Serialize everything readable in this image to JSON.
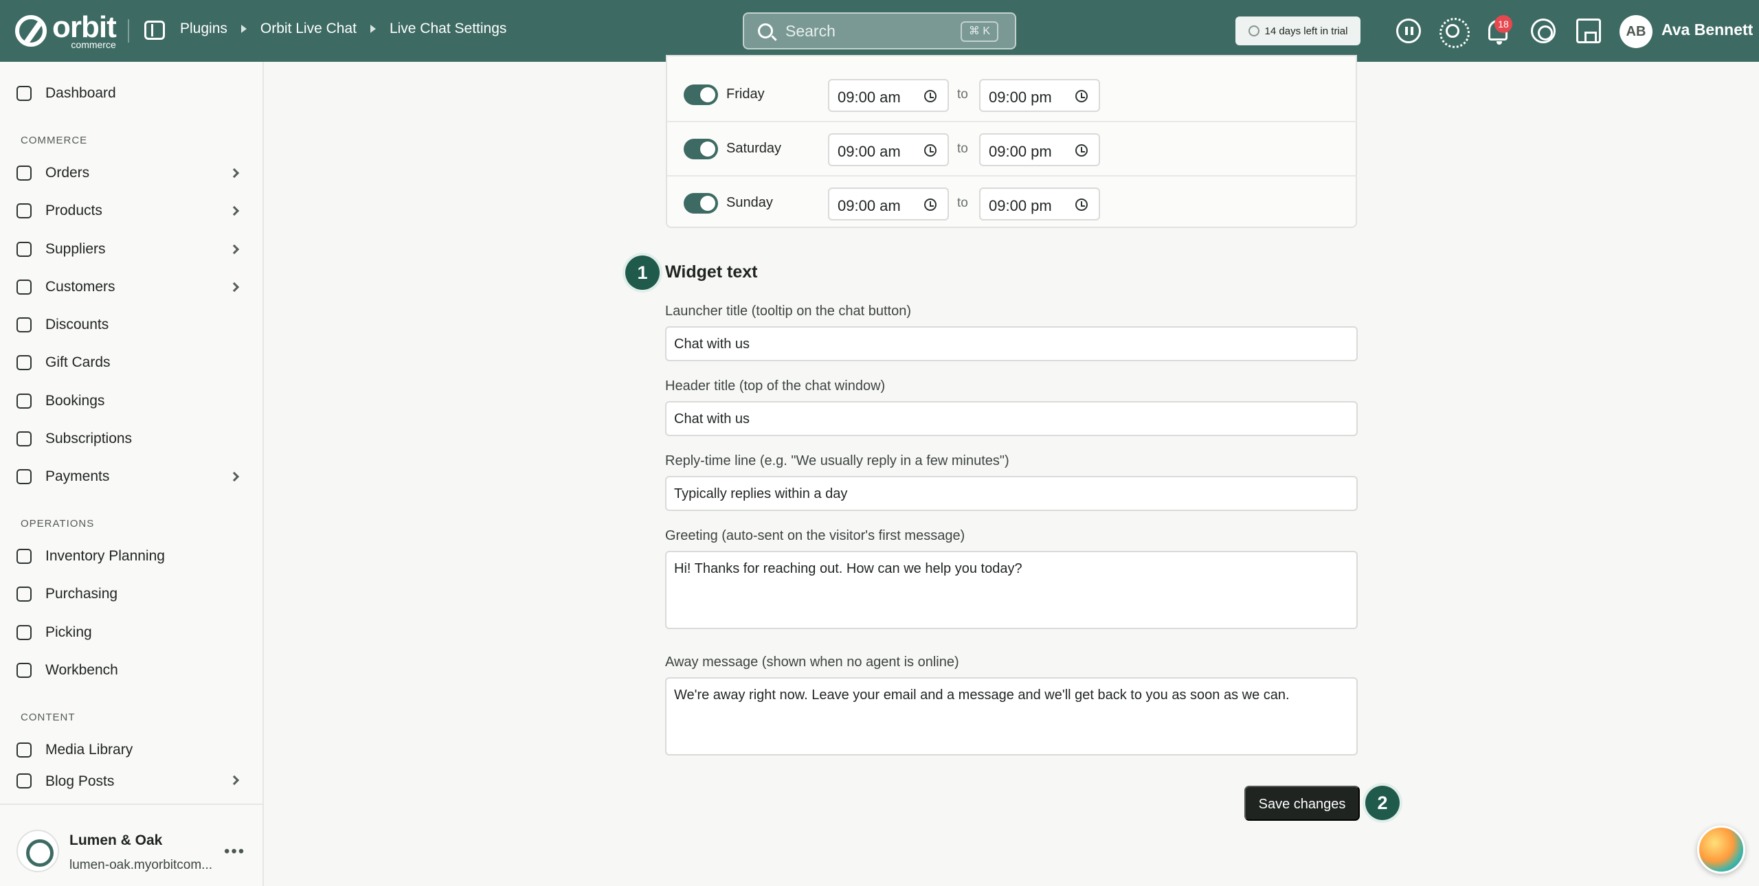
{
  "header": {
    "logo_word": "orbit",
    "logo_sub": "commerce",
    "breadcrumbs": [
      "Plugins",
      "Orbit Live Chat",
      "Live Chat Settings"
    ],
    "search_placeholder": "Search",
    "search_shortcut": "⌘ K",
    "trial_text": "14 days left in trial",
    "notification_count": "18",
    "avatar_initials": "AB",
    "user_name": "Ava Bennett"
  },
  "sidebar": {
    "dashboard": "Dashboard",
    "section_commerce": "COMMERCE",
    "commerce_items": [
      {
        "label": "Orders",
        "icon": "orders-icon",
        "chevron": true
      },
      {
        "label": "Products",
        "icon": "box-icon",
        "chevron": true
      },
      {
        "label": "Suppliers",
        "icon": "building-icon",
        "chevron": true
      },
      {
        "label": "Customers",
        "icon": "users-icon",
        "chevron": true
      },
      {
        "label": "Discounts",
        "icon": "tag-icon",
        "chevron": false
      },
      {
        "label": "Gift Cards",
        "icon": "gift-icon",
        "chevron": false
      },
      {
        "label": "Bookings",
        "icon": "calendar-icon",
        "chevron": false
      },
      {
        "label": "Subscriptions",
        "icon": "refresh-icon",
        "chevron": false
      },
      {
        "label": "Payments",
        "icon": "card-icon",
        "chevron": true
      }
    ],
    "section_operations": "OPERATIONS",
    "operations_items": [
      {
        "label": "Inventory Planning",
        "icon": "clipboard-icon"
      },
      {
        "label": "Purchasing",
        "icon": "box-plus-icon"
      },
      {
        "label": "Picking",
        "icon": "pin-icon"
      },
      {
        "label": "Workbench",
        "icon": "cube-icon"
      }
    ],
    "section_content": "CONTENT",
    "content_items": [
      {
        "label": "Media Library",
        "icon": "image-icon",
        "chevron": false
      },
      {
        "label": "Blog Posts",
        "icon": "document-icon",
        "chevron": true
      }
    ],
    "store_name": "Lumen & Oak",
    "store_url": "lumen-oak.myorbitcom..."
  },
  "hours": {
    "to_label": "to",
    "rows": [
      {
        "day": "Friday",
        "open": "09:00 am",
        "close": "09:00 pm",
        "enabled": true
      },
      {
        "day": "Saturday",
        "open": "09:00 am",
        "close": "09:00 pm",
        "enabled": true
      },
      {
        "day": "Sunday",
        "open": "09:00 am",
        "close": "09:00 pm",
        "enabled": true
      }
    ]
  },
  "widget_text": {
    "step_number": "1",
    "heading": "Widget text",
    "launcher_label": "Launcher title (tooltip on the chat button)",
    "launcher_value": "Chat with us",
    "header_label": "Header title (top of the chat window)",
    "header_value": "Chat with us",
    "reply_label": "Reply-time line (e.g. \"We usually reply in a few minutes\")",
    "reply_value": "Typically replies within a day",
    "greeting_label": "Greeting (auto-sent on the visitor's first message)",
    "greeting_value": "Hi! Thanks for reaching out. How can we help you today?",
    "away_label": "Away message (shown when no agent is online)",
    "away_value": "We're away right now. Leave your email and a message and we'll get back to you as soon as we can."
  },
  "actions": {
    "save_label": "Save changes",
    "step_number": "2"
  },
  "colors": {
    "header_bg": "#3d6b63",
    "accent": "#1f5a4b",
    "button_bg": "#1f2421"
  }
}
